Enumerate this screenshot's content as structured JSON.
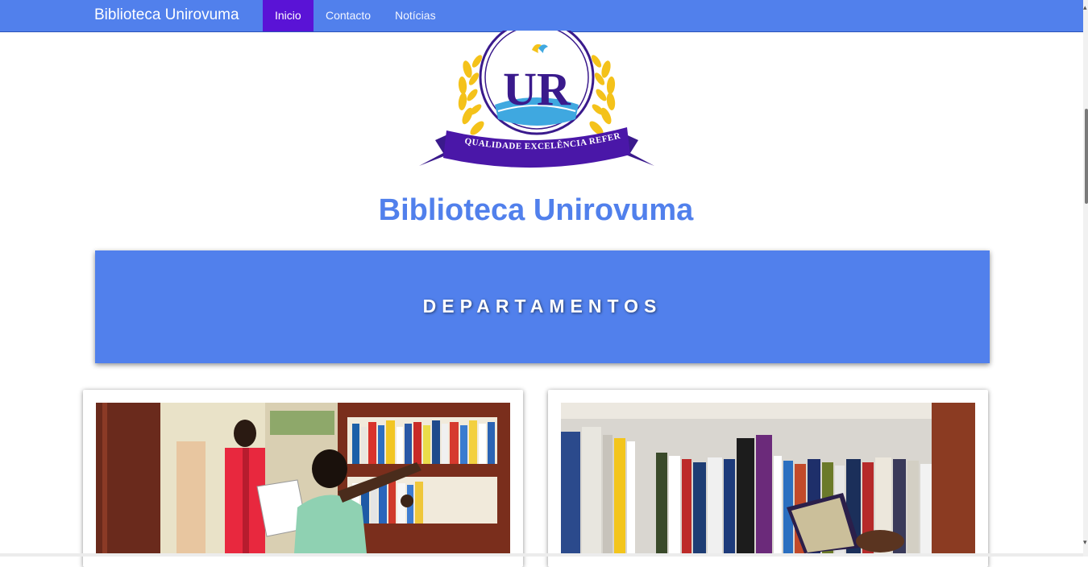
{
  "navbar": {
    "brand": "Biblioteca Unirovuma",
    "items": [
      {
        "label": "Inicio",
        "active": true
      },
      {
        "label": "Contacto",
        "active": false
      },
      {
        "label": "Notícias",
        "active": false
      }
    ],
    "background": "#5180ec",
    "active_background": "#5a13d6"
  },
  "logo": {
    "monogram": "UR",
    "ribbon_text": "QUALIDADE  EXCELÊNCIA  REFERÊNCIA"
  },
  "page": {
    "title": "Biblioteca Unirovuma"
  },
  "departments": {
    "heading": "DEPARTAMENTOS",
    "cards": [
      {
        "photo": "students-at-bookshelf-photo"
      },
      {
        "photo": "books-on-shelf-photo"
      }
    ]
  }
}
